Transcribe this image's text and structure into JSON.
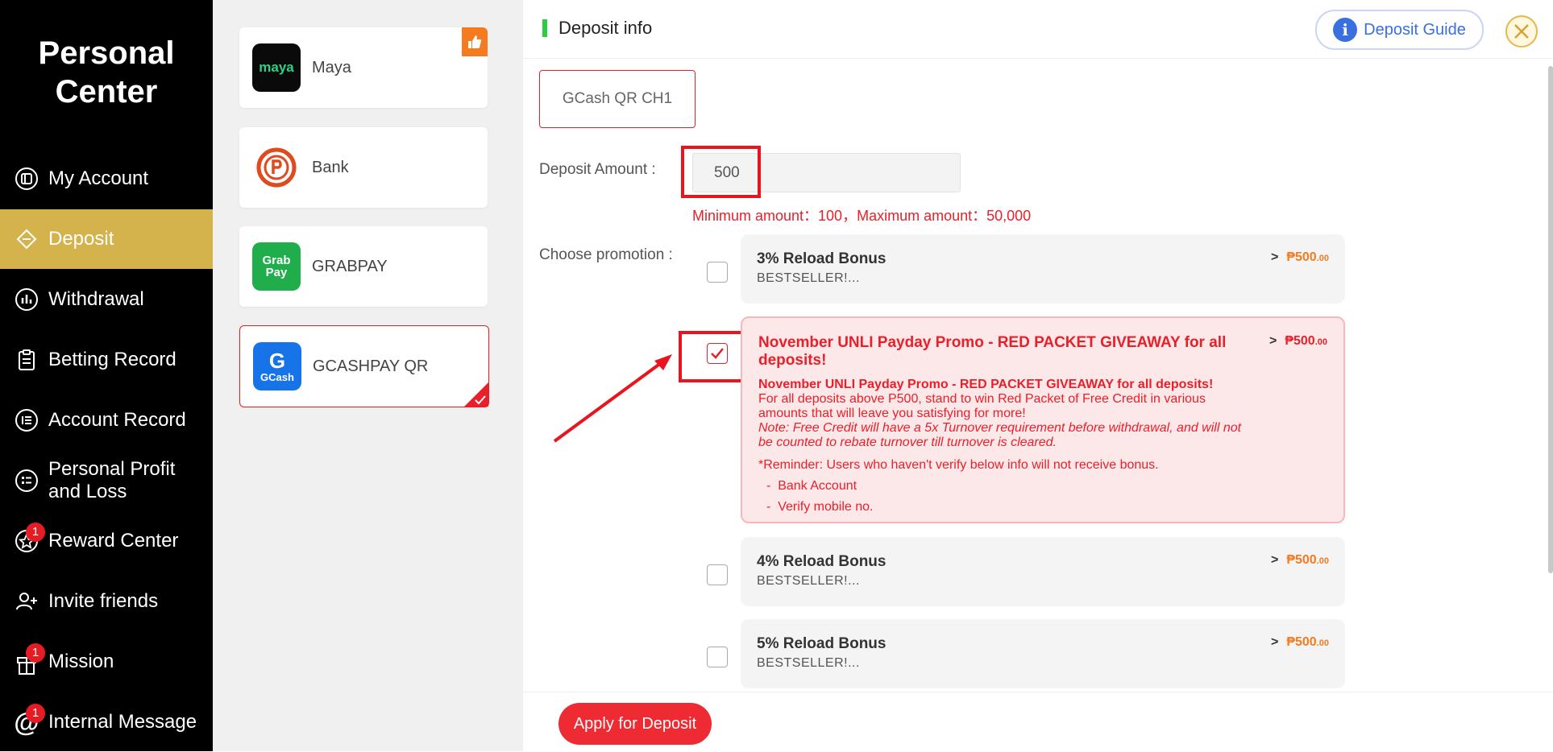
{
  "sidebar": {
    "title": "Personal Center",
    "items": [
      {
        "label": "My Account",
        "icon": "account-icon",
        "active": false
      },
      {
        "label": "Deposit",
        "icon": "deposit-icon",
        "active": true
      },
      {
        "label": "Withdrawal",
        "icon": "withdrawal-icon",
        "active": false
      },
      {
        "label": "Betting Record",
        "icon": "clipboard-icon",
        "active": false
      },
      {
        "label": "Account Record",
        "icon": "record-icon",
        "active": false
      },
      {
        "label": "Personal Profit and Loss",
        "icon": "list-icon",
        "active": false
      },
      {
        "label": "Reward Center",
        "icon": "star-icon",
        "active": false,
        "badge": "1"
      },
      {
        "label": "Invite friends",
        "icon": "add-user-icon",
        "active": false
      },
      {
        "label": "Mission",
        "icon": "gift-icon",
        "active": false,
        "badge": "1"
      },
      {
        "label": "Internal Message",
        "icon": "at-icon",
        "active": false,
        "badge": "1"
      }
    ]
  },
  "methods": [
    {
      "name": "Maya",
      "logo_text": "maya",
      "logo_color": "#0a0a0a",
      "logo_text_color": "#2cd18a",
      "recommended": true
    },
    {
      "name": "Bank",
      "logo_text": "P",
      "logo_color": "#ffffff",
      "logo_text_color": "#e04a1f"
    },
    {
      "name": "GRABPAY",
      "logo_text": "Grab Pay",
      "logo_color": "#1fae4b",
      "logo_text_color": "#ffffff"
    },
    {
      "name": "GCASHPAY QR",
      "logo_text": "GCash",
      "logo_color": "#1773e8",
      "logo_text_color": "#ffffff",
      "selected": true
    }
  ],
  "main": {
    "header_title": "Deposit info",
    "guide_button": "Deposit Guide",
    "channel": "GCash QR CH1",
    "amount_label": "Deposit Amount :",
    "amount_value": "500",
    "amount_hint": "Minimum amount：100，Maximum amount：50,000",
    "promo_label": "Choose promotion :",
    "promos": [
      {
        "title": "3% Reload Bonus",
        "subtitle": "BESTSELLER!...",
        "amount": "₱500",
        "cents": ".00",
        "checked": false
      },
      {
        "title": "November UNLI Payday Promo - RED PACKET GIVEAWAY for all deposits!",
        "amount": "₱500",
        "cents": ".00",
        "checked": true,
        "detail_heading": "November UNLI Payday Promo - RED PACKET GIVEAWAY for all deposits!",
        "detail_body": "For all deposits above P500, stand to win Red Packet of Free Credit in various amounts that will leave you satisfying for more!",
        "detail_note": "Note: Free Credit will have a 5x Turnover requirement before withdrawal, and will not be counted to rebate turnover till turnover is cleared.",
        "detail_reminder": "*Reminder: Users who haven't verify below info will not receive bonus.",
        "detail_list": [
          "Bank Account",
          "Verify mobile no."
        ]
      },
      {
        "title": "4% Reload Bonus",
        "subtitle": "BESTSELLER!...",
        "amount": "₱500",
        "cents": ".00",
        "checked": false
      },
      {
        "title": "5% Reload Bonus",
        "subtitle": "BESTSELLER!...",
        "amount": "₱500",
        "cents": ".00",
        "checked": false
      }
    ],
    "apply_button": "Apply for Deposit"
  },
  "colors": {
    "active_nav": "#d4b24c",
    "accent_red": "#e8202a",
    "amount_orange": "#f47b20",
    "guide_blue": "#3a6fe0"
  }
}
